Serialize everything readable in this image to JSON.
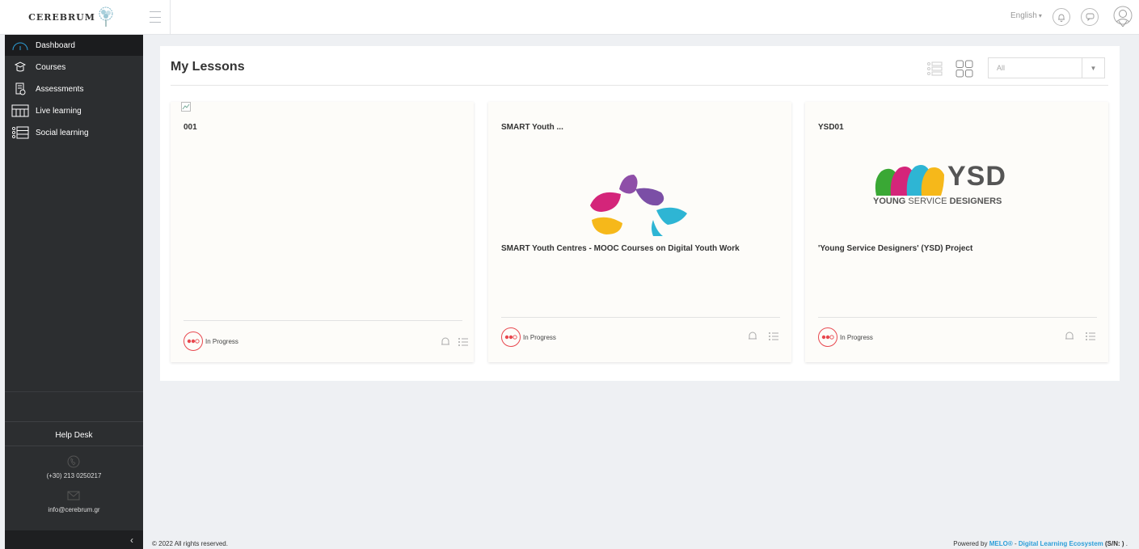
{
  "header": {
    "logo_text": "Cerebrum",
    "language": "English",
    "icons": [
      "bell-icon",
      "chat-icon",
      "user-avatar-icon"
    ]
  },
  "sidebar": {
    "items": [
      {
        "label": "Dashboard",
        "icon": "dashboard-gauge-icon",
        "active": true
      },
      {
        "label": "Courses",
        "icon": "graduation-cap-icon"
      },
      {
        "label": "Assessments",
        "icon": "clipboard-check-icon"
      },
      {
        "label": "Live learning",
        "icon": "classroom-icon"
      },
      {
        "label": "Social learning",
        "icon": "people-list-icon"
      }
    ],
    "help_desk": "Help Desk",
    "phone": "(+30) 213 0250217",
    "email": "info@cerebrum.gr"
  },
  "main": {
    "title": "My Lessons",
    "filter": {
      "value": "All"
    },
    "cards": [
      {
        "code": "001",
        "title": "",
        "status": "In Progress"
      },
      {
        "code": "SMART Youth ...",
        "title": "SMART Youth Centres - MOOC Courses on Digital Youth Work",
        "status": "In Progress"
      },
      {
        "code": "YSD01",
        "title": "'Young Service Designers' (YSD) Project",
        "status": "In Progress",
        "logo_text_main": "YSD",
        "logo_text_bold": "YOUNG",
        "logo_text_rest": " SERVICE ",
        "logo_text_bold2": "DESIGNERS"
      }
    ]
  },
  "footer": {
    "copyright": "© 2022 All rights reserved.",
    "powered_prefix": "Powered by ",
    "brand": "MELO®",
    "separator": " - ",
    "ecosystem": "Digital Learning Ecosystem",
    "sn": " (S/N: )",
    "suffix": " ."
  },
  "colors": {
    "sidebar_bg": "#2c2e30",
    "accent": "#2d9fd9",
    "status_red": "#e8484f"
  }
}
